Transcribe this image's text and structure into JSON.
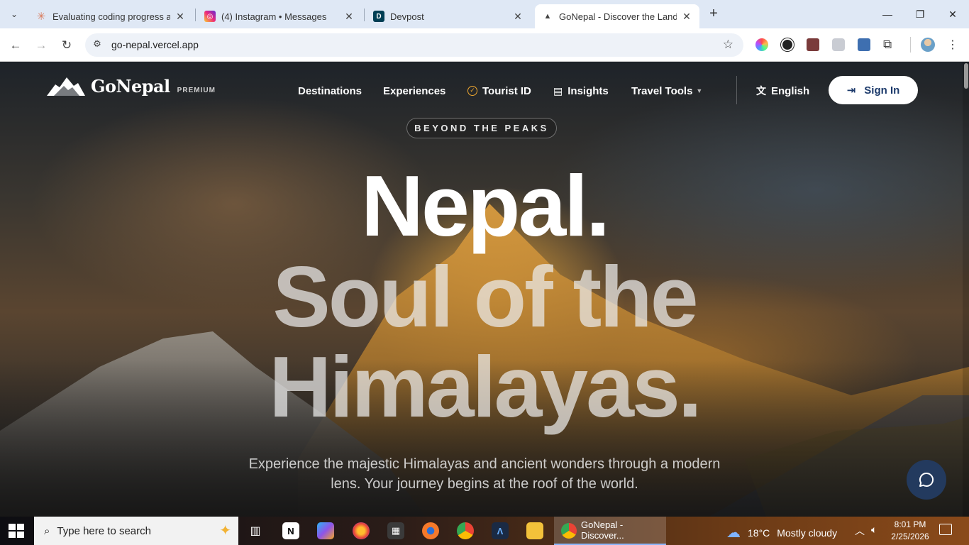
{
  "browser": {
    "tabs": [
      {
        "title": "Evaluating coding progress as a",
        "favicon": "claude-icon",
        "color": "#d97757"
      },
      {
        "title": "(4) Instagram • Messages",
        "favicon": "instagram-icon",
        "color": "#d6249f"
      },
      {
        "title": "Devpost",
        "favicon": "devpost-icon",
        "color": "#003e54"
      },
      {
        "title": "GoNepal - Discover the Land of",
        "favicon": "gonepal-icon",
        "color": "#444444"
      }
    ],
    "url": "go-nepal.vercel.app"
  },
  "site": {
    "brand": {
      "name": "GoNepal",
      "tag": "PREMIUM"
    },
    "nav": {
      "destinations": "Destinations",
      "experiences": "Experiences",
      "tourist_id": "Tourist ID",
      "insights": "Insights",
      "travel_tools": "Travel Tools",
      "language": "English",
      "sign_in": "Sign In"
    },
    "hero": {
      "pill": "BEYOND THE PEAKS",
      "line1": "Nepal.",
      "line2": "Soul of the",
      "line3": "Himalayas.",
      "sub": "Experience the majestic Himalayas and ancient wonders through a modern lens. Your journey begins at the roof of the world."
    },
    "colors": {
      "accent": "#f0a830",
      "signin_text": "#1c3a6b",
      "chat_bg": "#233a5e"
    }
  },
  "taskbar": {
    "search_placeholder": "Type here to search",
    "active_app": "GoNepal - Discover...",
    "weather": {
      "temp": "18°C",
      "desc": "Mostly cloudy"
    },
    "time": "8:01 PM",
    "date": "2/25/2026"
  }
}
